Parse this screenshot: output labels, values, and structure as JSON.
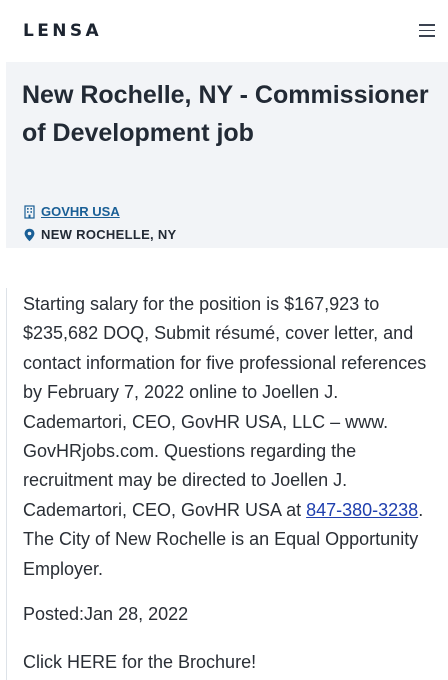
{
  "header": {
    "logo": "LENSA",
    "menu_icon": "hamburger-menu-icon"
  },
  "job": {
    "title": "New Rochelle, NY - Commissioner of Development job",
    "company": "GOVHR USA",
    "company_icon": "building-icon",
    "location": "NEW ROCHELLE, NY",
    "location_icon": "map-pin-icon"
  },
  "description": {
    "text_before_phone": "Starting salary for the position is $167,923 to $235,682 DOQ, Submit résumé, cover letter, and contact information for five professional references by February 7, 2022 online to Joellen J. Cademartori, CEO, GovHR USA, LLC – www. GovHRjobs.com. Questions regarding the recruitment may be directed to Joellen J. Cademartori, CEO, GovHR USA at ",
    "phone": "847-380-3238",
    "text_after_phone": ". The City of New Rochelle is an Equal Opportunity Employer.",
    "posted": "Posted:Jan 28, 2022",
    "brochure": "Click HERE for the Brochure!"
  },
  "colors": {
    "header_bg": "#f2f4f7",
    "link": "#1a5f96",
    "phone_link": "#1f3fae",
    "text": "#2a2f36"
  }
}
